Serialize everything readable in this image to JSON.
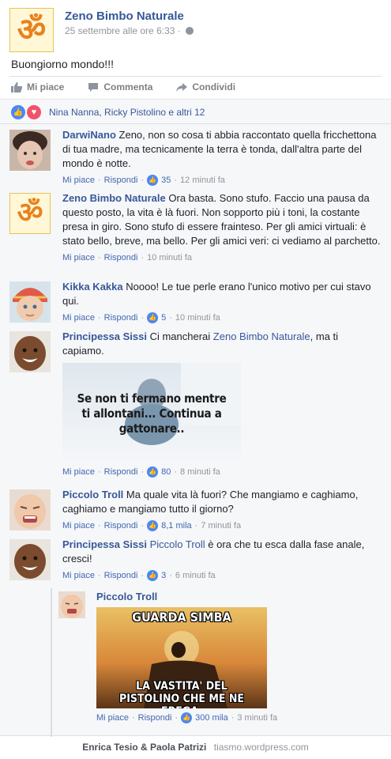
{
  "post": {
    "author": "Zeno Bimbo Naturale",
    "time": "25 settembre alle ore 6:33 ·",
    "text": "Buongiorno mondo!!!",
    "om_symbol": "ॐ"
  },
  "actions": {
    "like": "Mi piace",
    "comment": "Commenta",
    "share": "Condividi"
  },
  "reactions": {
    "summary": "Nina Nanna, Ricky Pistolino e altri 12",
    "colors": {
      "like": "#4a86f7",
      "love": "#f25268"
    }
  },
  "comments": [
    {
      "author": "DarwiNano",
      "text": "Zeno, non so cosa ti abbia raccontato quella fricchettona di tua madre, ma tecnicamente la terra è tonda, dall'altra parte del mondo è notte.",
      "like": "Mi piace",
      "reply": "Rispondi",
      "likes": "35",
      "time": "12 minuti fa"
    },
    {
      "author": "Zeno Bimbo Naturale",
      "text": "Ora basta. Sono stufo. Faccio una pausa da questo posto, la vita è là fuori. Non sopporto più i toni, la costante presa in giro. Sono stufo di essere frainteso. Per gli amici virtuali: è stato bello, breve, ma bello. Per gli amici veri: ci vediamo al parchetto.",
      "like": "Mi piace",
      "reply": "Rispondi",
      "time": "10 minuti fa"
    },
    {
      "author": "Kikka Kakka",
      "text": "Noooo! Le tue perle erano l'unico motivo per cui stavo qui.",
      "like": "Mi piace",
      "reply": "Rispondi",
      "likes": "5",
      "time": "10 minuti fa"
    },
    {
      "author": "Principessa Sissi",
      "text_before": "Ci mancherai",
      "mention": "Zeno Bimbo Naturale",
      "text_after": ", ma ti capiamo.",
      "image_text": "Se non ti fermano mentre ti allontani... Continua a gattonare..",
      "like": "Mi piace",
      "reply": "Rispondi",
      "likes": "80",
      "time": "8 minuti fa"
    },
    {
      "author": "Piccolo Troll",
      "text": "Ma quale vita là fuori? Che mangiamo e caghiamo, caghiamo e mangiamo tutto il giorno?",
      "like": "Mi piace",
      "reply": "Rispondi",
      "likes": "8,1 mila",
      "time": "7 minuti fa"
    },
    {
      "author": "Principessa Sissi",
      "mention": "Piccolo Troll",
      "text_after": "è ora che tu esca dalla fase anale, cresci!",
      "like": "Mi piace",
      "reply": "Rispondi",
      "likes": "3",
      "time": "6 minuti fa"
    },
    {
      "author": "Piccolo Troll",
      "image_top": "GUARDA SIMBA",
      "image_bottom": "LA VASTITA' DEL PISTOLINO CHE ME NE FREGA.",
      "like": "Mi piace",
      "reply": "Rispondi",
      "likes": "300 mila",
      "time": "3 minuti fa"
    }
  ],
  "footer": {
    "authors": "Enrica Tesio & Paola Patrizi",
    "site": "tiasmo.wordpress.com"
  }
}
